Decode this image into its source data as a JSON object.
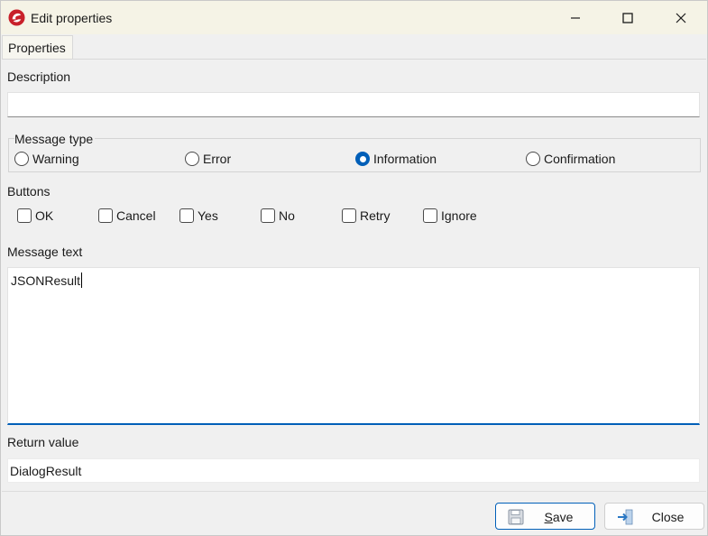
{
  "window": {
    "title": "Edit properties"
  },
  "tabs": [
    {
      "label": "Properties"
    }
  ],
  "description": {
    "label": "Description",
    "value": ""
  },
  "message_type": {
    "label": "Message type",
    "options": [
      {
        "label": "Warning",
        "checked": false
      },
      {
        "label": "Error",
        "checked": false
      },
      {
        "label": "Information",
        "checked": true
      },
      {
        "label": "Confirmation",
        "checked": false
      }
    ]
  },
  "buttons_group": {
    "label": "Buttons",
    "options": [
      {
        "label": "OK",
        "checked": false
      },
      {
        "label": "Cancel",
        "checked": false
      },
      {
        "label": "Yes",
        "checked": false
      },
      {
        "label": "No",
        "checked": false
      },
      {
        "label": "Retry",
        "checked": false
      },
      {
        "label": "Ignore",
        "checked": false
      }
    ]
  },
  "message_text": {
    "label": "Message text",
    "value": "JSONResult"
  },
  "return_value": {
    "label": "Return value",
    "value": "DialogResult"
  },
  "actions": {
    "save_label": "Save",
    "close_label": "Close"
  },
  "icons": {
    "app": "app-logo-icon",
    "minimize": "minimize-icon",
    "maximize": "maximize-icon",
    "close": "close-icon",
    "save": "floppy-disk-icon",
    "exit": "exit-arrow-icon"
  },
  "colors": {
    "accent": "#005fb8",
    "titlebar": "#f5f3e6",
    "app_icon": "#c8202a"
  }
}
